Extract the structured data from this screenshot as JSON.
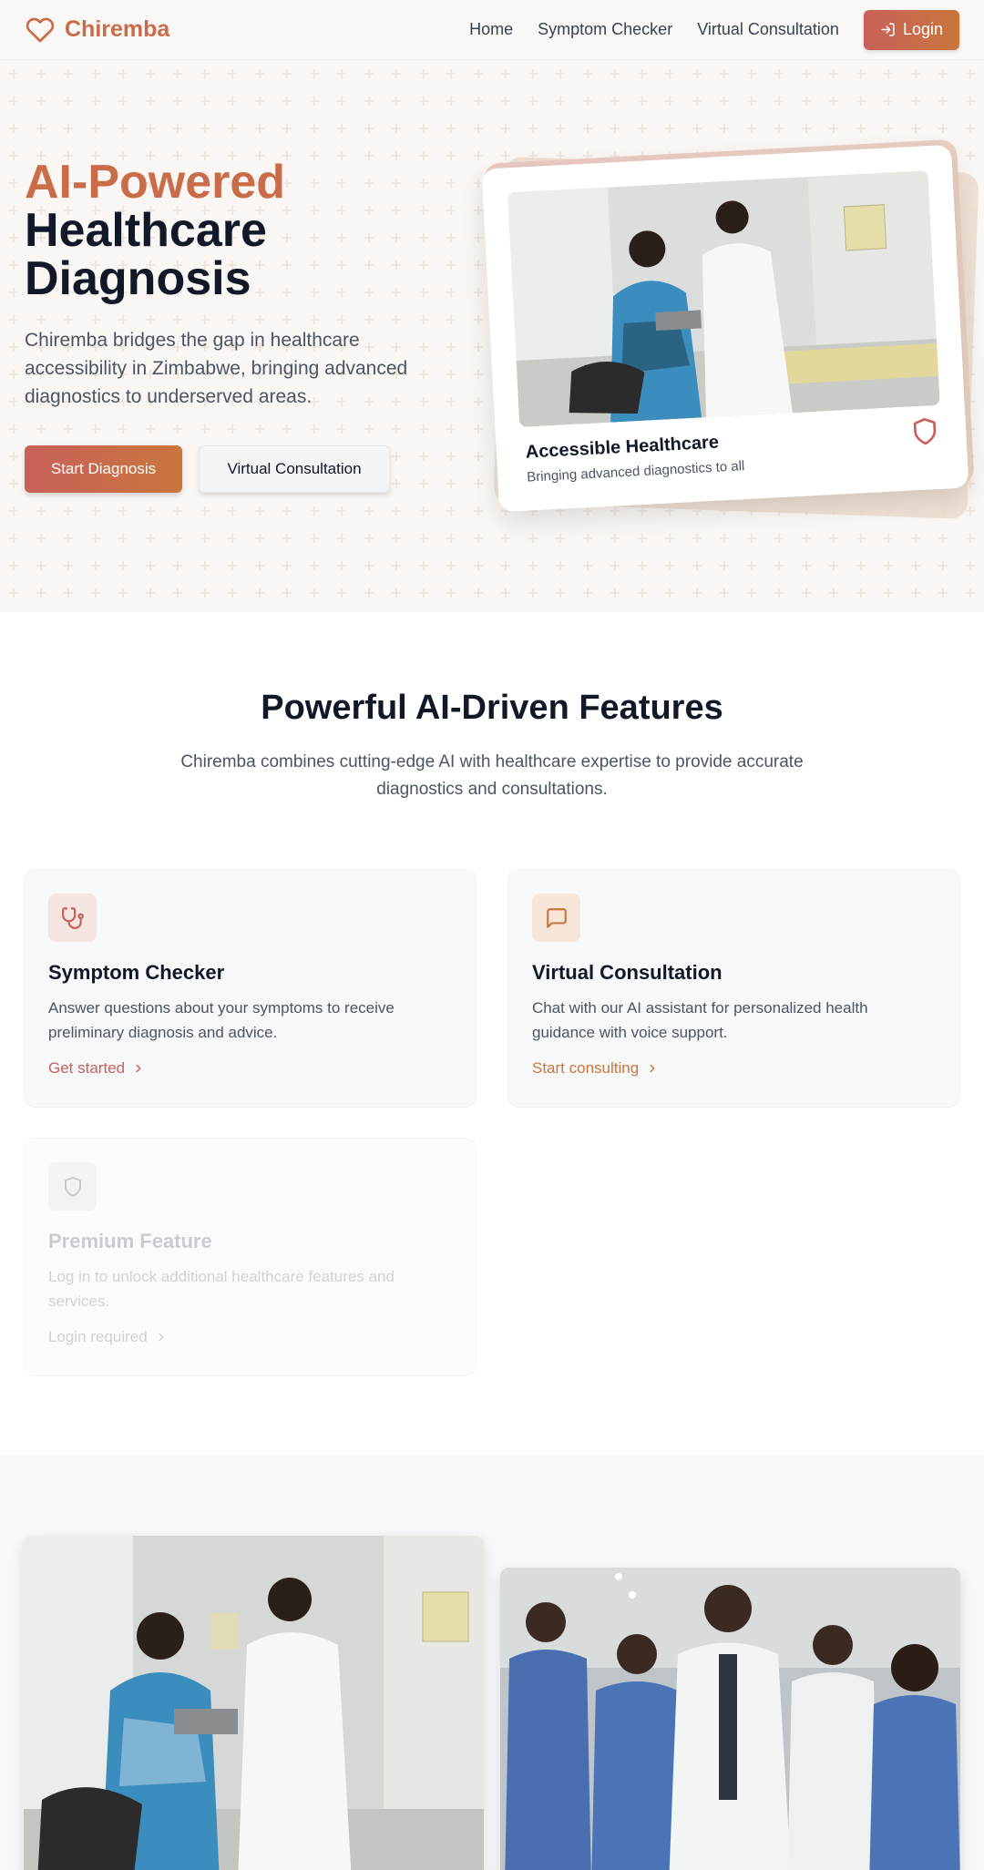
{
  "nav": {
    "brand": "Chiremba",
    "links": [
      "Home",
      "Symptom Checker",
      "Virtual Consultation"
    ],
    "login_label": "Login"
  },
  "hero": {
    "title_accent": "AI-Powered",
    "title_line2": "Healthcare",
    "title_line3": "Diagnosis",
    "subtitle": "Chiremba bridges the gap in healthcare accessibility in Zimbabwe, bringing advanced diagnostics to underserved areas.",
    "primary_button": "Start Diagnosis",
    "secondary_button": "Virtual Consultation",
    "card": {
      "title": "Accessible Healthcare",
      "subtitle": "Bringing advanced diagnostics to all"
    }
  },
  "features": {
    "title": "Powerful AI-Driven Features",
    "subtitle": "Chiremba combines cutting-edge AI with healthcare expertise to provide accurate diagnostics and consultations.",
    "cards": [
      {
        "title": "Symptom Checker",
        "description": "Answer questions about your symptoms to receive preliminary diagnosis and advice.",
        "link": "Get started",
        "icon": "stethoscope-icon",
        "color": "#c8605a"
      },
      {
        "title": "Virtual Consultation",
        "description": "Chat with our AI assistant for personalized health guidance with voice support.",
        "link": "Start consulting",
        "icon": "chat-icon",
        "color": "#c9763c"
      },
      {
        "title": "Premium Feature",
        "description": "Log in to unlock additional healthcare features and services.",
        "link": "Login required",
        "icon": "shield-icon",
        "color": "#9ca3af"
      }
    ]
  },
  "colors": {
    "brand": "#c96c4a",
    "primary_gradient_start": "#c8605a",
    "primary_gradient_end": "#c9763c",
    "text_dark": "#111827",
    "text_muted": "#4b5563"
  }
}
